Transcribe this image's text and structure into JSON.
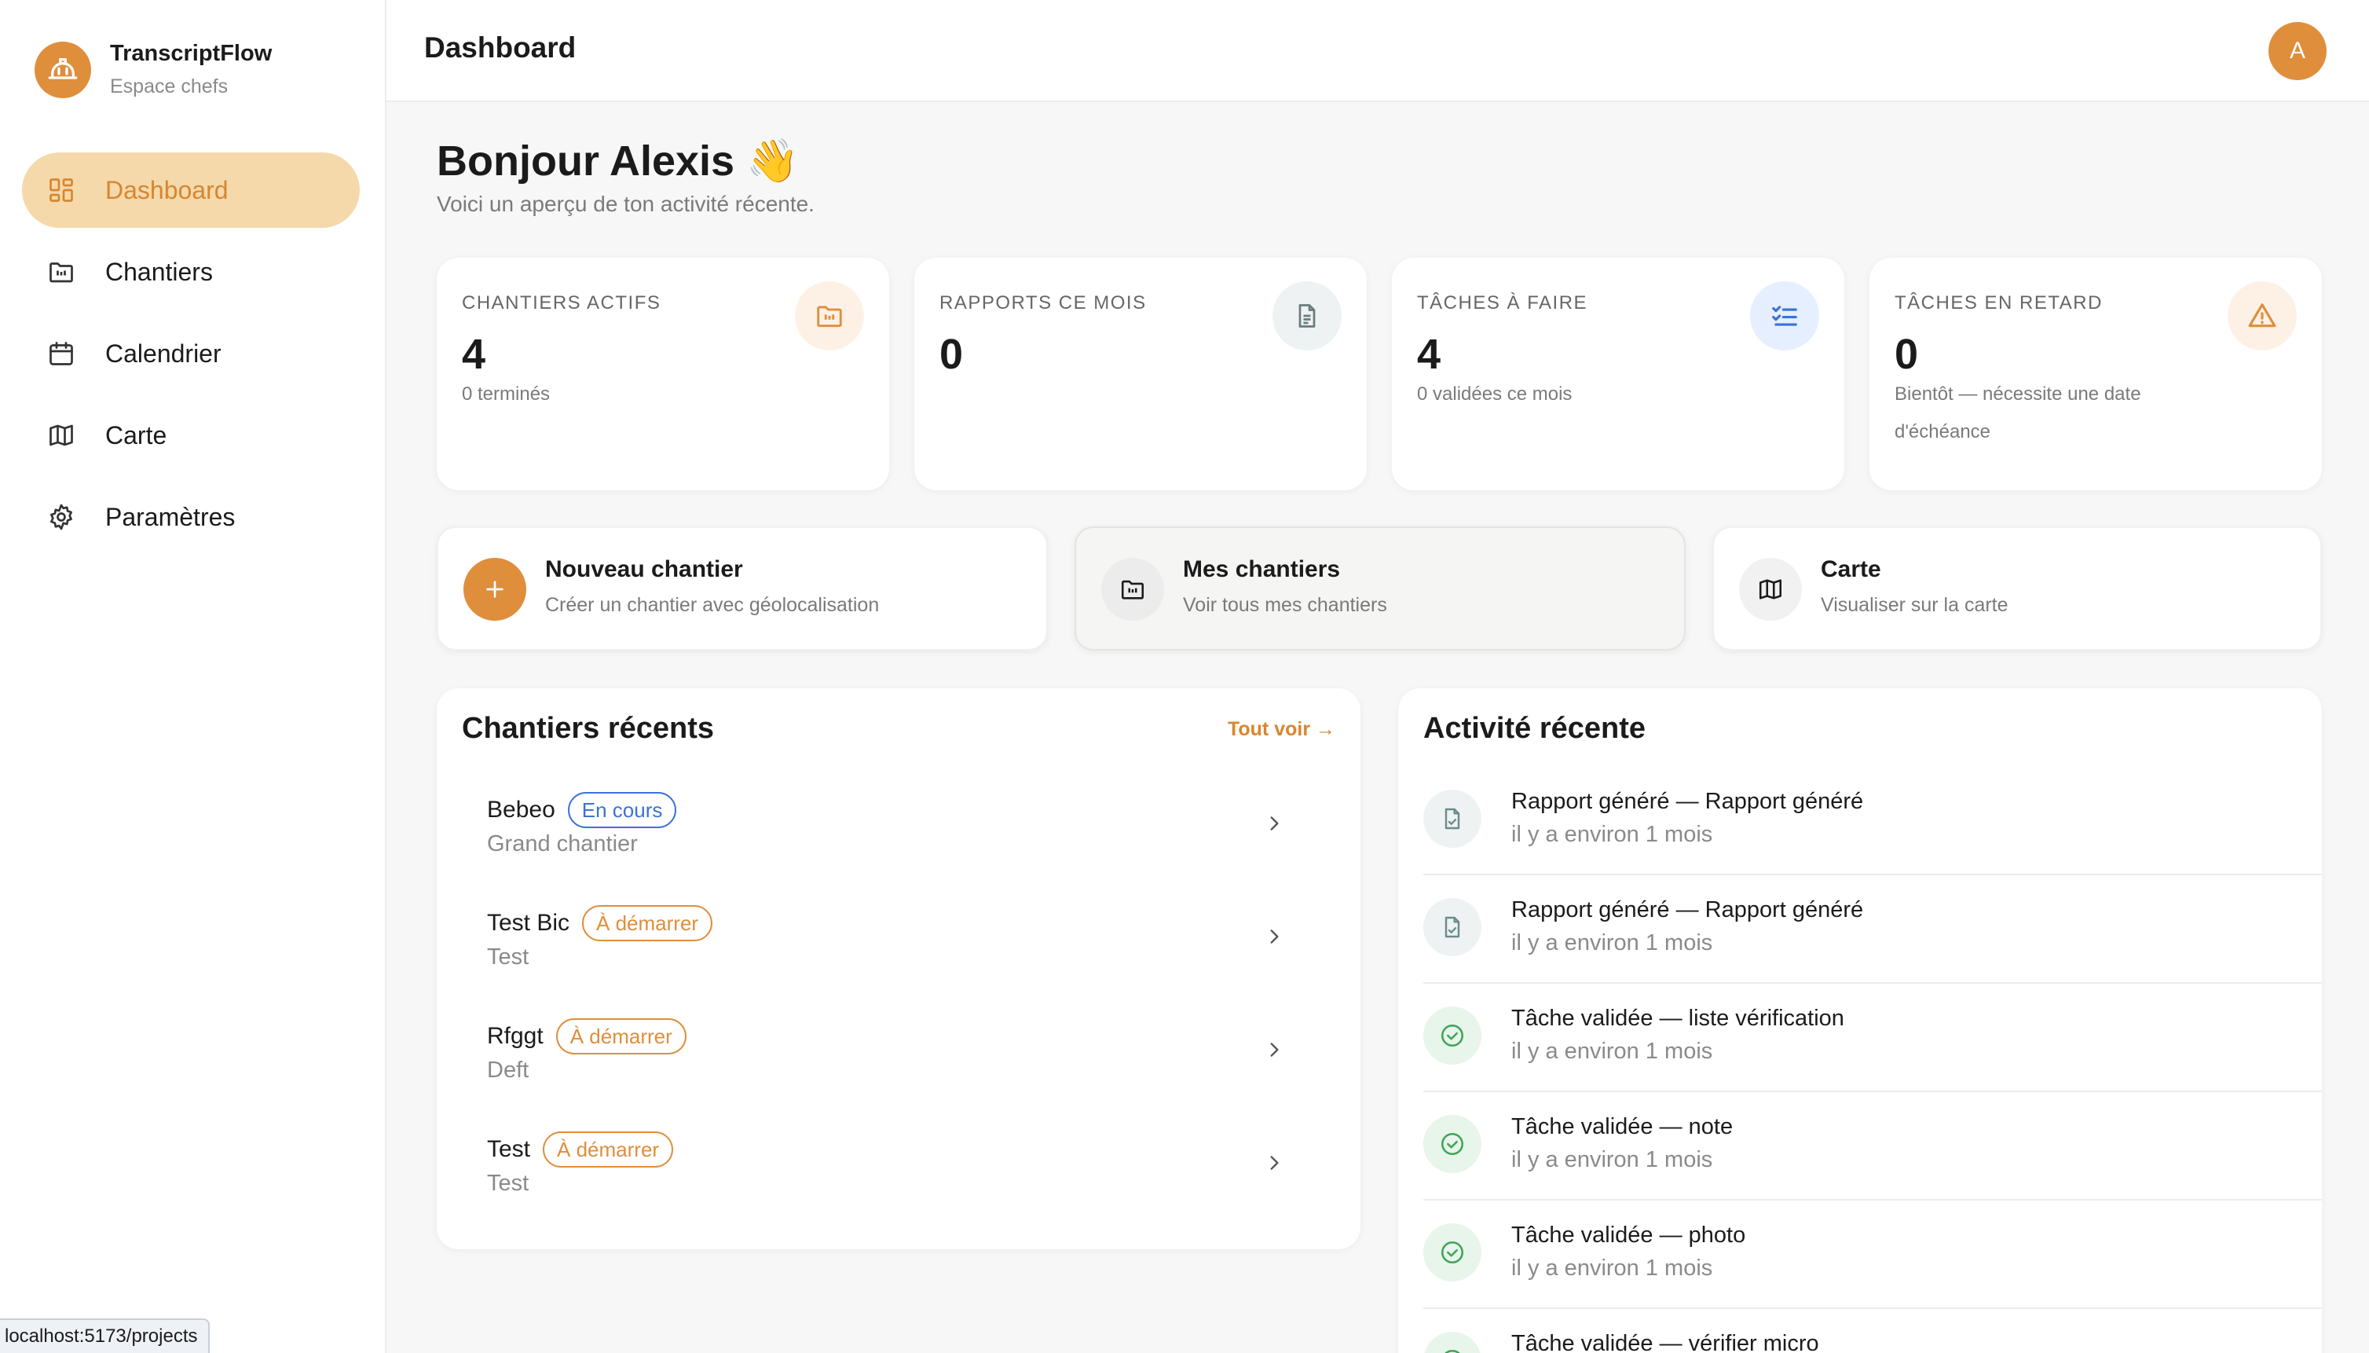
{
  "app": {
    "name": "TranscriptFlow",
    "subtitle": "Espace chefs",
    "logo_icon": "hard-hat-icon",
    "accent": "#df8e3c"
  },
  "sidebar": {
    "items": [
      {
        "label": "Dashboard",
        "icon": "dashboard-grid-icon",
        "active": true
      },
      {
        "label": "Chantiers",
        "icon": "folder-icon",
        "active": false
      },
      {
        "label": "Calendrier",
        "icon": "calendar-icon",
        "active": false
      },
      {
        "label": "Carte",
        "icon": "map-icon",
        "active": false
      },
      {
        "label": "Paramètres",
        "icon": "gear-icon",
        "active": false
      }
    ]
  },
  "status_url": "localhost:5173/projects",
  "header": {
    "title": "Dashboard",
    "avatar_initial": "A"
  },
  "greeting": {
    "title": "Bonjour Alexis 👋",
    "subtitle": "Voici un aperçu de ton activité récente."
  },
  "stats": [
    {
      "label": "CHANTIERS ACTIFS",
      "value": "4",
      "sub": "0 terminés",
      "icon": "folder-icon",
      "color": "#df8e3c",
      "bg": "#fdf1e6"
    },
    {
      "label": "RAPPORTS CE MOIS",
      "value": "0",
      "sub": "",
      "icon": "document-icon",
      "color": "#6b7b7b",
      "bg": "#eef2f2"
    },
    {
      "label": "TÂCHES À FAIRE",
      "value": "4",
      "sub": "0 validées ce mois",
      "icon": "checklist-icon",
      "color": "#3b72d8",
      "bg": "#e6efff"
    },
    {
      "label": "TÂCHES EN RETARD",
      "value": "0",
      "sub": "Bientôt — nécessite une date d'échéance",
      "icon": "warning-icon",
      "color": "#df8e3c",
      "bg": "#fdf1e6"
    }
  ],
  "actions": [
    {
      "title": "Nouveau chantier",
      "sub": "Créer un chantier avec géolocalisation",
      "icon": "plus-icon"
    },
    {
      "title": "Mes chantiers",
      "sub": "Voir tous mes chantiers",
      "icon": "folder-icon"
    },
    {
      "title": "Carte",
      "sub": "Visualiser sur la carte",
      "icon": "map-icon"
    }
  ],
  "recent_projects": {
    "title": "Chantiers récents",
    "see_all": "Tout voir →",
    "items": [
      {
        "name": "Bebeo",
        "status": "En cours",
        "status_color": "blue",
        "sub": "Grand chantier"
      },
      {
        "name": "Test Bic",
        "status": "À démarrer",
        "status_color": "orange",
        "sub": "Test"
      },
      {
        "name": "Rfggt",
        "status": "À démarrer",
        "status_color": "orange",
        "sub": "Deft"
      },
      {
        "name": "Test",
        "status": "À démarrer",
        "status_color": "orange",
        "sub": "Test"
      }
    ]
  },
  "recent_activity": {
    "title": "Activité récente",
    "items": [
      {
        "title": "Rapport généré — Rapport généré",
        "time": "il y a environ 1 mois",
        "icon": "document-check-icon"
      },
      {
        "title": "Rapport généré — Rapport généré",
        "time": "il y a environ 1 mois",
        "icon": "document-check-icon"
      },
      {
        "title": "Tâche validée — liste vérification",
        "time": "il y a environ 1 mois",
        "icon": "check-circle-icon"
      },
      {
        "title": "Tâche validée — note",
        "time": "il y a environ 1 mois",
        "icon": "check-circle-icon"
      },
      {
        "title": "Tâche validée — photo",
        "time": "il y a environ 1 mois",
        "icon": "check-circle-icon"
      },
      {
        "title": "Tâche validée — vérifier micro",
        "time": "",
        "icon": "check-circle-icon"
      }
    ]
  }
}
